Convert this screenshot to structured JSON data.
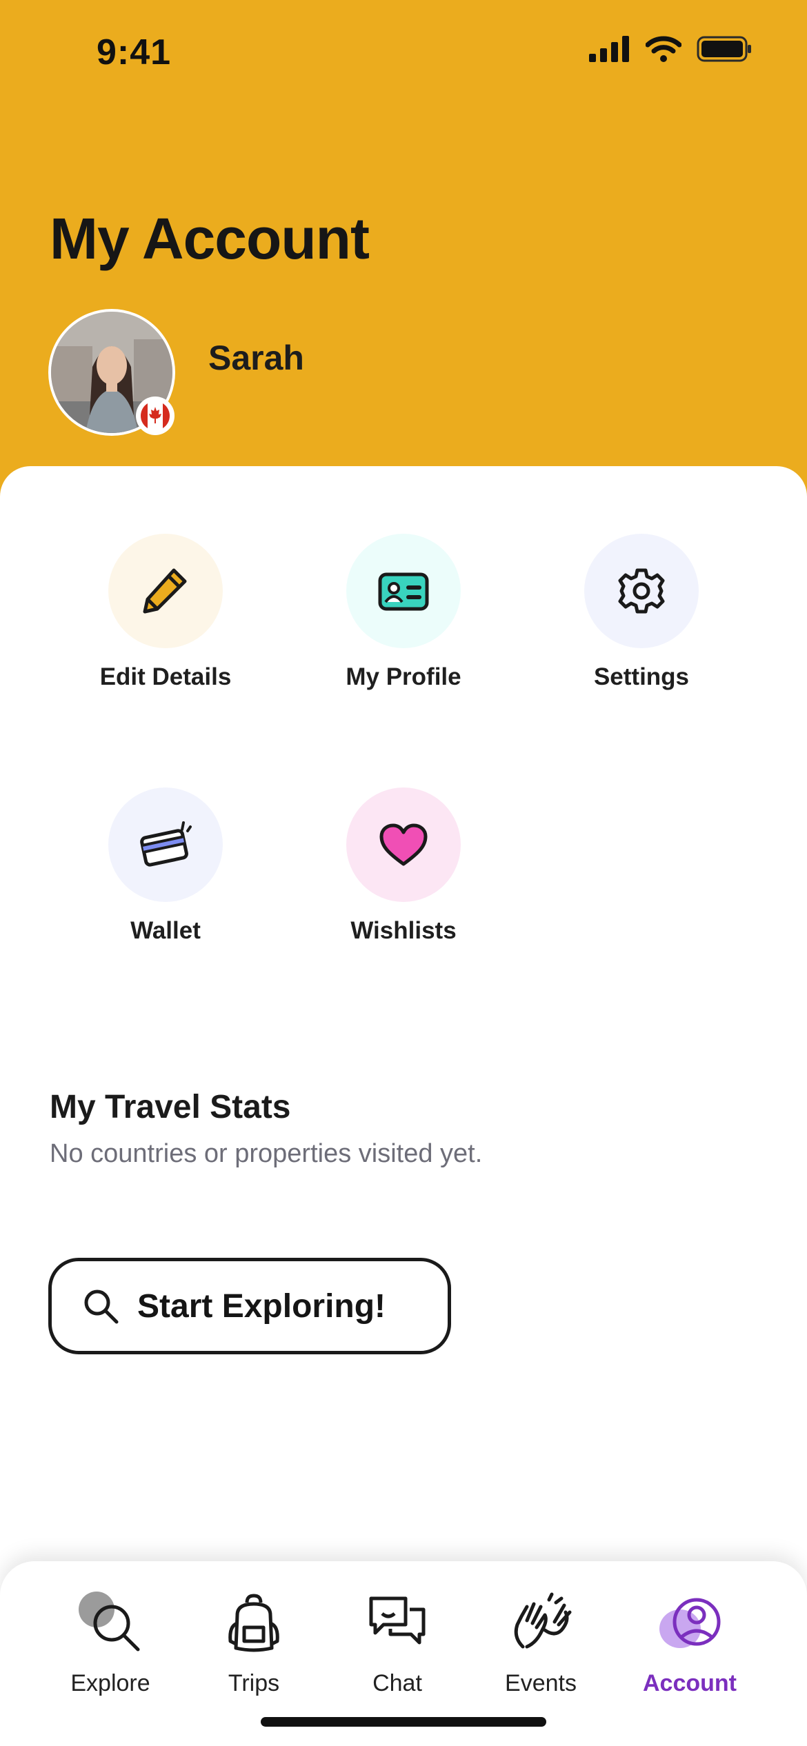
{
  "status_bar": {
    "time": "9:41"
  },
  "header": {
    "title": "My Account",
    "user_name": "Sarah",
    "flag_icon": "canada-flag-icon",
    "background": "#EBAC1E"
  },
  "actions": [
    {
      "label": "Edit Details",
      "icon": "pencil-icon",
      "bg": "#FDF6E8"
    },
    {
      "label": "My Profile",
      "icon": "id-card-icon",
      "bg": "#ECFDFB"
    },
    {
      "label": "Settings",
      "icon": "gear-icon",
      "bg": "#F1F3FD"
    },
    {
      "label": "Wallet",
      "icon": "credit-card-icon",
      "bg": "#F1F3FD"
    },
    {
      "label": "Wishlists",
      "icon": "heart-icon",
      "bg": "#FCE6F4"
    }
  ],
  "travel_stats": {
    "title": "My Travel Stats",
    "subtitle": "No countries or properties visited yet."
  },
  "cta": {
    "label": "Start Exploring!",
    "icon": "search-icon"
  },
  "tabs": [
    {
      "label": "Explore",
      "icon": "search-icon"
    },
    {
      "label": "Trips",
      "icon": "backpack-icon"
    },
    {
      "label": "Chat",
      "icon": "chat-bubbles-icon"
    },
    {
      "label": "Events",
      "icon": "waving-hands-icon"
    },
    {
      "label": "Account",
      "icon": "user-circle-icon",
      "active": true
    }
  ],
  "colors": {
    "accent": "#7B2FBE",
    "header": "#EBAC1E"
  }
}
